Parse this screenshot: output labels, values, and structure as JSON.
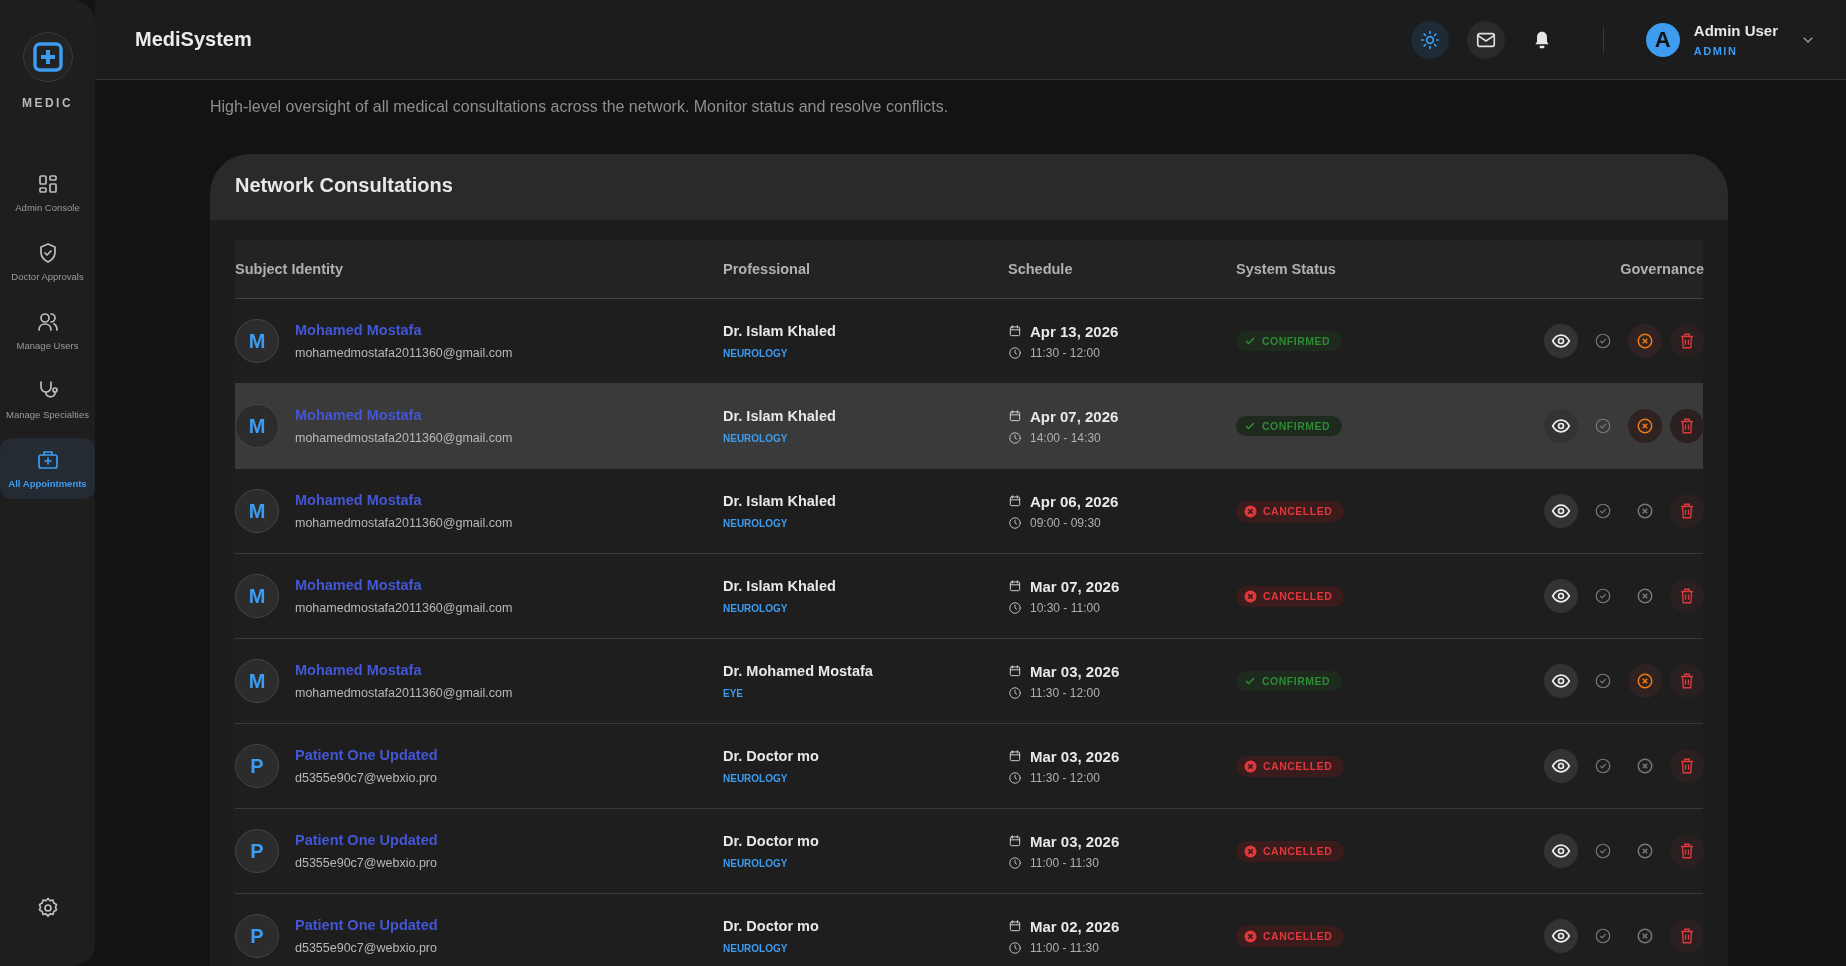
{
  "sidebar": {
    "brand": "MEDIC",
    "items": [
      {
        "label": "Admin Console",
        "selected": false
      },
      {
        "label": "Doctor Approvals",
        "selected": false
      },
      {
        "label": "Manage Users",
        "selected": false
      },
      {
        "label": "Manage Specialties",
        "selected": false
      },
      {
        "label": "All Appointments",
        "selected": true
      }
    ]
  },
  "header": {
    "app_name": "MediSystem",
    "user": {
      "initial": "A",
      "name": "Admin User",
      "role": "ADMIN"
    }
  },
  "subtitle": "High-level oversight of all medical consultations across the network. Monitor status and resolve conflicts.",
  "card": {
    "title": "Network Consultations",
    "table": {
      "columns": [
        "Subject Identity",
        "Professional",
        "Schedule",
        "System Status",
        "Governance"
      ],
      "rows": [
        {
          "initial": "M",
          "name": "Mohamed Mostafa",
          "email": "mohamedmostafa2011360@gmail.com",
          "doctor": "Dr. Islam Khaled",
          "specialty": "NEUROLOGY",
          "date": "Apr 13, 2026",
          "time": "11:30 - 12:00",
          "status": "CONFIRMED",
          "kind": "confirmed",
          "highlighted": false
        },
        {
          "initial": "M",
          "name": "Mohamed Mostafa",
          "email": "mohamedmostafa2011360@gmail.com",
          "doctor": "Dr. Islam Khaled",
          "specialty": "NEUROLOGY",
          "date": "Apr 07, 2026",
          "time": "14:00 - 14:30",
          "status": "CONFIRMED",
          "kind": "confirmed",
          "highlighted": true
        },
        {
          "initial": "M",
          "name": "Mohamed Mostafa",
          "email": "mohamedmostafa2011360@gmail.com",
          "doctor": "Dr. Islam Khaled",
          "specialty": "NEUROLOGY",
          "date": "Apr 06, 2026",
          "time": "09:00 - 09:30",
          "status": "CANCELLED",
          "kind": "cancelled",
          "highlighted": false
        },
        {
          "initial": "M",
          "name": "Mohamed Mostafa",
          "email": "mohamedmostafa2011360@gmail.com",
          "doctor": "Dr. Islam Khaled",
          "specialty": "NEUROLOGY",
          "date": "Mar 07, 2026",
          "time": "10:30 - 11:00",
          "status": "CANCELLED",
          "kind": "cancelled",
          "highlighted": false
        },
        {
          "initial": "M",
          "name": "Mohamed Mostafa",
          "email": "mohamedmostafa2011360@gmail.com",
          "doctor": "Dr. Mohamed Mostafa",
          "specialty": "EYE",
          "date": "Mar 03, 2026",
          "time": "11:30 - 12:00",
          "status": "CONFIRMED",
          "kind": "confirmed",
          "highlighted": false
        },
        {
          "initial": "P",
          "name": "Patient One Updated",
          "email": "d5355e90c7@webxio.pro",
          "doctor": "Dr. Doctor mo",
          "specialty": "NEUROLOGY",
          "date": "Mar 03, 2026",
          "time": "11:30 - 12:00",
          "status": "CANCELLED",
          "kind": "cancelled",
          "highlighted": false
        },
        {
          "initial": "P",
          "name": "Patient One Updated",
          "email": "d5355e90c7@webxio.pro",
          "doctor": "Dr. Doctor mo",
          "specialty": "NEUROLOGY",
          "date": "Mar 03, 2026",
          "time": "11:00 - 11:30",
          "status": "CANCELLED",
          "kind": "cancelled",
          "highlighted": false
        },
        {
          "initial": "P",
          "name": "Patient One Updated",
          "email": "d5355e90c7@webxio.pro",
          "doctor": "Dr. Doctor mo",
          "specialty": "NEUROLOGY",
          "date": "Mar 02, 2026",
          "time": "11:00 - 11:30",
          "status": "CANCELLED",
          "kind": "cancelled",
          "highlighted": false
        }
      ]
    }
  }
}
